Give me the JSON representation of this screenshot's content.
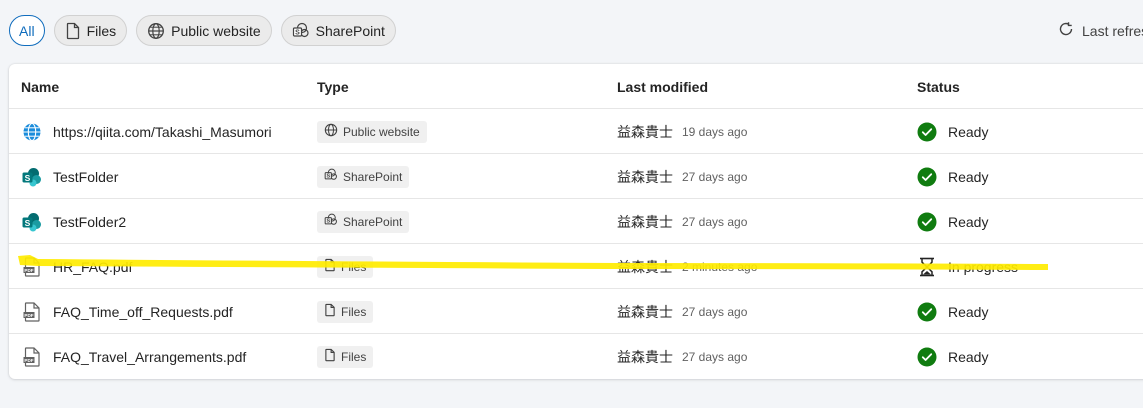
{
  "filters": [
    {
      "label": "All",
      "icon": "none",
      "selected": true
    },
    {
      "label": "Files",
      "icon": "file-icon",
      "selected": false
    },
    {
      "label": "Public website",
      "icon": "globe-icon",
      "selected": false
    },
    {
      "label": "SharePoint",
      "icon": "sharepoint-icon",
      "selected": false
    }
  ],
  "refresh": {
    "label": "Last refres"
  },
  "table": {
    "headers": {
      "name": "Name",
      "type": "Type",
      "modified": "Last modified",
      "status": "Status"
    },
    "rows": [
      {
        "name": "https://qiita.com/Takashi_Masumori",
        "icon": "globe-icon",
        "type": "Public website",
        "type_icon": "globe-icon",
        "user": "益森貴士",
        "ago": "19 days ago",
        "status": "Ready",
        "status_icon": "check-circle-icon"
      },
      {
        "name": "TestFolder",
        "icon": "sharepoint-icon",
        "type": "SharePoint",
        "type_icon": "sharepoint-icon",
        "user": "益森貴士",
        "ago": "27 days ago",
        "status": "Ready",
        "status_icon": "check-circle-icon"
      },
      {
        "name": "TestFolder2",
        "icon": "sharepoint-icon",
        "type": "SharePoint",
        "type_icon": "sharepoint-icon",
        "user": "益森貴士",
        "ago": "27 days ago",
        "status": "Ready",
        "status_icon": "check-circle-icon"
      },
      {
        "name": "HR_FAQ.pdf",
        "icon": "pdf-icon",
        "type": "Files",
        "type_icon": "file-icon",
        "user": "益森貴士",
        "ago": "2 minutes ago",
        "status": "In progress",
        "status_icon": "hourglass-icon"
      },
      {
        "name": "FAQ_Time_off_Requests.pdf",
        "icon": "pdf-icon",
        "type": "Files",
        "type_icon": "file-icon",
        "user": "益森貴士",
        "ago": "27 days ago",
        "status": "Ready",
        "status_icon": "check-circle-icon"
      },
      {
        "name": "FAQ_Travel_Arrangements.pdf",
        "icon": "pdf-icon",
        "type": "Files",
        "type_icon": "file-icon",
        "user": "益森貴士",
        "ago": "27 days ago",
        "status": "Ready",
        "status_icon": "check-circle-icon"
      }
    ]
  },
  "colors": {
    "accent": "#0f6cbd",
    "ready": "#107c10",
    "highlight": "#ffeb00",
    "sharepoint": "#036c70"
  }
}
